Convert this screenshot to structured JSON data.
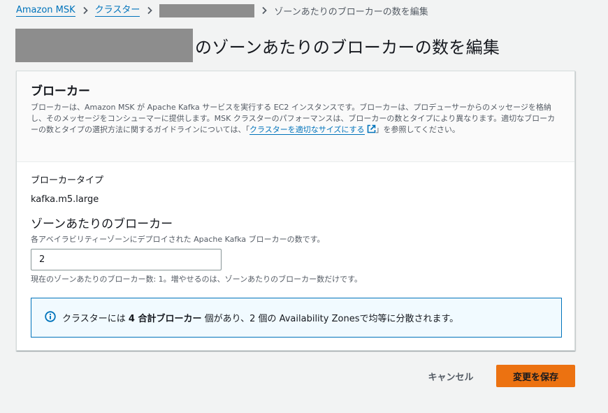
{
  "breadcrumb": {
    "root": "Amazon MSK",
    "clusters": "クラスター",
    "current": "ゾーンあたりのブローカーの数を編集"
  },
  "page": {
    "title_suffix": "のゾーンあたりのブローカーの数を編集"
  },
  "panel": {
    "heading": "ブローカー",
    "description_before": "ブローカーは、Amazon MSK が Apache Kafka サービスを実行する EC2 インスタンスです。ブローカーは、プロデューサーからのメッセージを格納し、そのメッセージをコンシューマーに提供します。MSK クラスターのパフォーマンスは、ブローカーの数とタイプにより異なります。適切なブローカーの数とタイプの選択方法に関するガイドラインについては、「",
    "description_link": "クラスターを適切なサイズにする",
    "description_after": "」を参照してください。"
  },
  "broker_type": {
    "label": "ブローカータイプ",
    "value": "kafka.m5.large"
  },
  "brokers_per_zone": {
    "label": "ゾーンあたりのブローカー",
    "hint": "各アベイラビリティーゾーンにデプロイされた Apache Kafka ブローカーの数です。",
    "value": "2",
    "note": "現在のゾーンあたりのブローカー数: 1。増やせるのは、ゾーンあたりのブローカー数だけです。"
  },
  "info": {
    "before": "クラスターには ",
    "bold": "4 合計ブローカー",
    "after": " 個があり、2 個の Availability Zonesで均等に分散されます。"
  },
  "actions": {
    "cancel": "キャンセル",
    "save": "変更を保存"
  },
  "colors": {
    "link": "#0073bb",
    "primary_button": "#ec7211",
    "info_border": "#0073bb"
  },
  "icons": {
    "breadcrumb_separator": "chevron-right-icon",
    "external_link": "external-link-icon",
    "info": "info-circle-icon"
  }
}
